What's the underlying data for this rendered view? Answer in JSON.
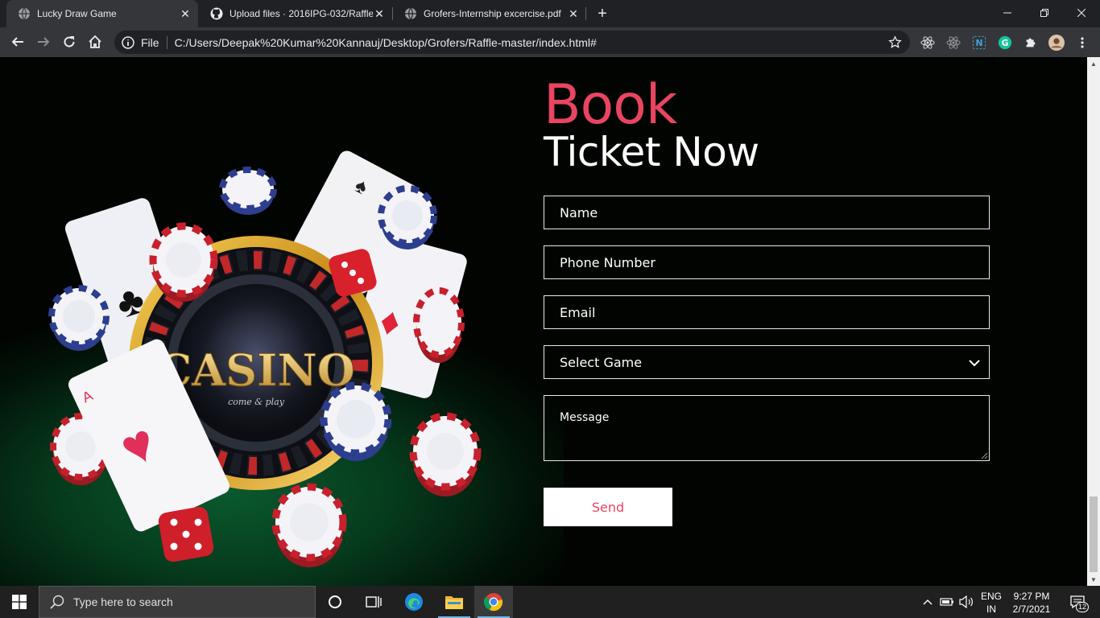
{
  "browser": {
    "tabs": [
      {
        "title": "Lucky Draw Game",
        "active": true,
        "icon": "globe-icon"
      },
      {
        "title": "Upload files · 2016IPG-032/Raffle",
        "active": false,
        "icon": "github-icon"
      },
      {
        "title": "Grofers-Internship excercise.pdf",
        "active": false,
        "icon": "globe-icon"
      }
    ],
    "scheme_label": "File",
    "url": "C:/Users/Deepak%20Kumar%20Kannauj/Desktop/Grofers/Raffle-master/index.html#",
    "extension_icons": [
      "react-devtools-icon",
      "redux-devtools-icon",
      "notion-icon",
      "grammarly-icon",
      "puzzle-icon",
      "profile-avatar-icon"
    ]
  },
  "page": {
    "heading_accent": "Book",
    "heading_main": "Ticket Now",
    "form": {
      "name_placeholder": "Name",
      "phone_placeholder": "Phone Number",
      "email_placeholder": "Email",
      "game_select_value": "Select Game",
      "message_placeholder": "Message",
      "send_label": "Send"
    },
    "hero_image": {
      "description_icons": [
        "roulette-wheel",
        "playing-cards",
        "casino-chips",
        "dice"
      ],
      "logo_text": "CASINO",
      "logo_tagline": "come & play"
    }
  },
  "colors": {
    "accent": "#e94560",
    "page_background": "#010401",
    "felt_green": "#0a5a2e",
    "chrome_dark": "#202124",
    "chrome_toolbar": "#35363a"
  },
  "taskbar": {
    "search_placeholder": "Type here to search",
    "language_line1": "ENG",
    "language_line2": "IN",
    "time": "9:27 PM",
    "date": "2/7/2021",
    "notification_count": "12"
  }
}
